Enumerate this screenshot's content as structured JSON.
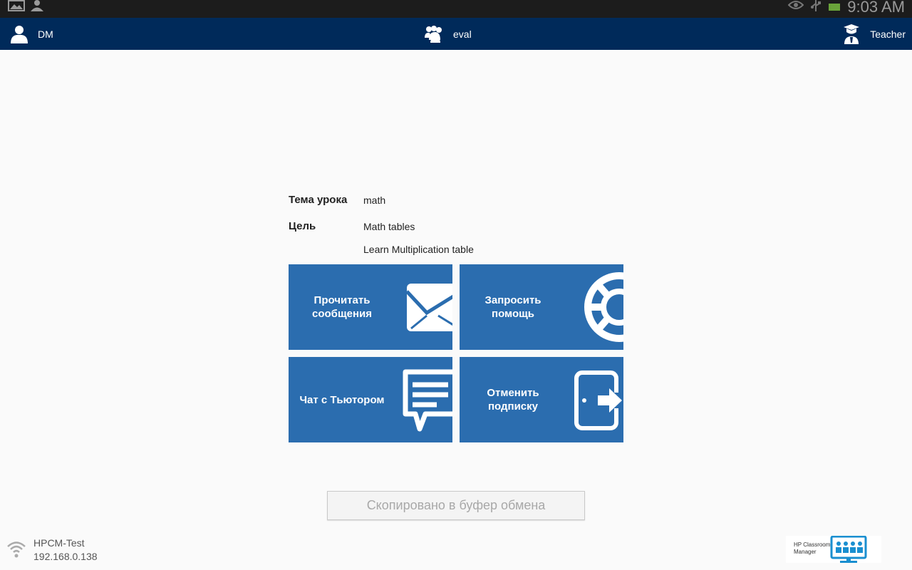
{
  "status_bar": {
    "time": "9:03 AM",
    "left_icons": [
      "image-icon",
      "person-icon"
    ],
    "right_icons": [
      "eye-icon",
      "usb-icon",
      "battery-icon"
    ]
  },
  "header": {
    "user": {
      "label": "DM",
      "icon": "user-icon"
    },
    "group": {
      "label": "eval",
      "icon": "group-icon"
    },
    "role": {
      "label": "Teacher",
      "icon": "teacher-icon"
    },
    "background": "#002a5a"
  },
  "lesson": {
    "topic_label": "Тема урока",
    "topic_value": "math",
    "goal_label": "Цель",
    "goal_values": [
      "Math tables",
      "Learn Multiplication table"
    ]
  },
  "tiles": [
    {
      "label": "Прочитать сообщения",
      "icon": "envelope-icon"
    },
    {
      "label": "Запросить помощь",
      "icon": "lifebuoy-icon"
    },
    {
      "label": "Чат с Тьютором",
      "icon": "chat-icon"
    },
    {
      "label": "Отменить подписку",
      "icon": "exit-door-icon"
    }
  ],
  "tile_color": "#2b6daf",
  "copy_button": {
    "label": "Скопировано в буфер обмена"
  },
  "network": {
    "name": "HPCM-Test",
    "ip": "192.168.0.138",
    "icon": "wifi-icon"
  },
  "brand": {
    "text": "HP Classroom Manager",
    "icon": "classroom-monitor-icon",
    "color": "#1a8fd0"
  }
}
